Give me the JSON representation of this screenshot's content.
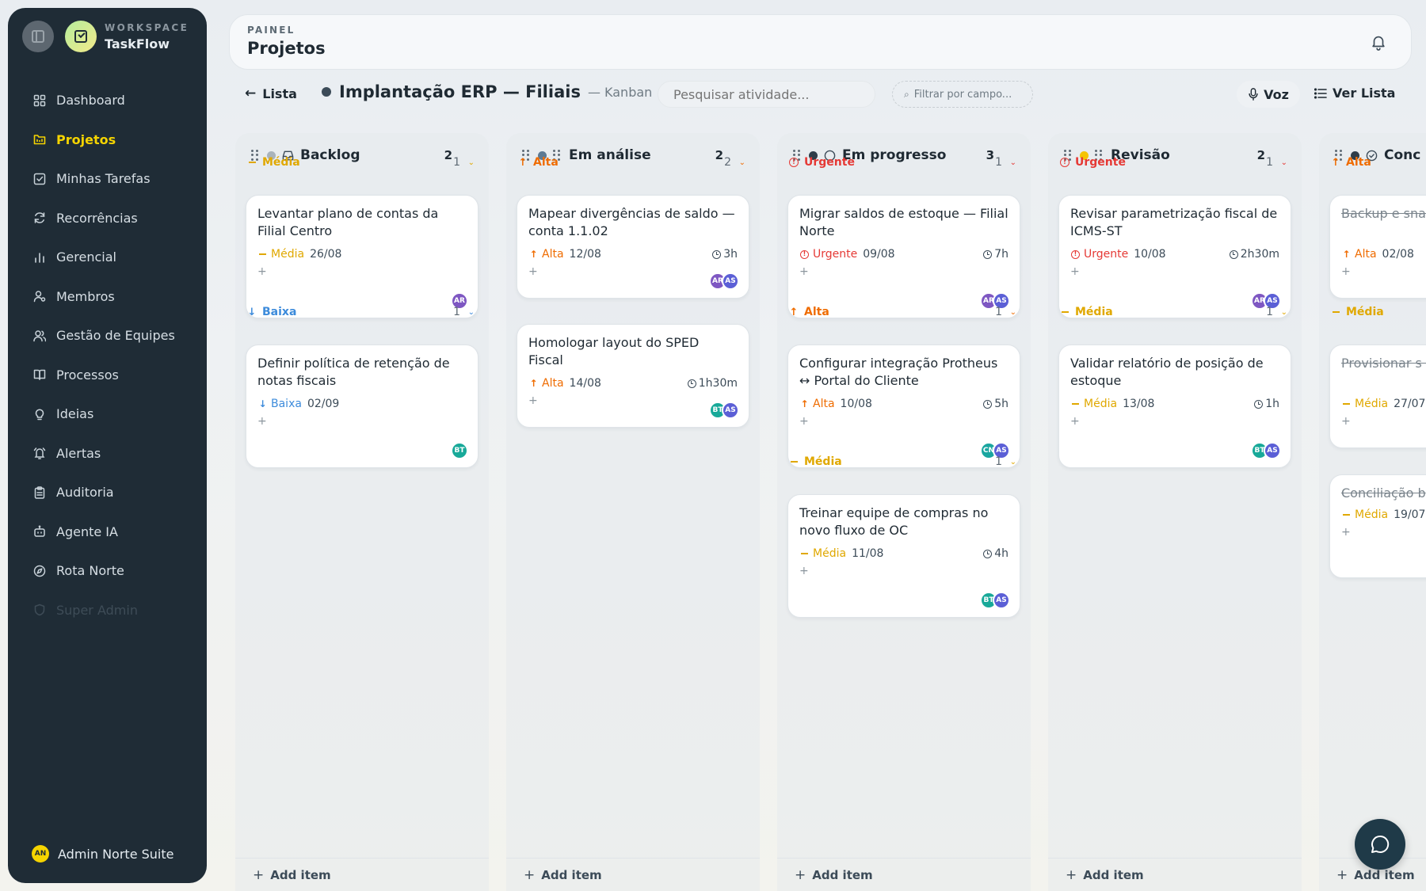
{
  "workspace": {
    "label": "WORKSPACE",
    "name": "TaskFlow"
  },
  "nav": [
    {
      "label": "Dashboard",
      "icon": "grid-icon",
      "state": "normal"
    },
    {
      "label": "Projetos",
      "icon": "folder-icon",
      "state": "active"
    },
    {
      "label": "Minhas Tarefas",
      "icon": "checkbox-icon",
      "state": "normal"
    },
    {
      "label": "Recorrências",
      "icon": "refresh-icon",
      "state": "normal"
    },
    {
      "label": "Gerencial",
      "icon": "bar-chart-icon",
      "state": "normal"
    },
    {
      "label": "Membros",
      "icon": "member-icon",
      "state": "normal"
    },
    {
      "label": "Gestão de Equipes",
      "icon": "users-icon",
      "state": "normal"
    },
    {
      "label": "Processos",
      "icon": "book-icon",
      "state": "normal"
    },
    {
      "label": "Ideias",
      "icon": "bulb-icon",
      "state": "normal"
    },
    {
      "label": "Alertas",
      "icon": "alarm-icon",
      "state": "normal"
    },
    {
      "label": "Auditoria",
      "icon": "clipboard-icon",
      "state": "normal"
    },
    {
      "label": "Agente IA",
      "icon": "bot-icon",
      "state": "normal"
    },
    {
      "label": "Rota Norte",
      "icon": "compass-icon",
      "state": "normal"
    },
    {
      "label": "Super Admin",
      "icon": "shield-icon",
      "state": "disabled"
    }
  ],
  "user": {
    "initials": "AN",
    "name": "Admin Norte Suite"
  },
  "header": {
    "section": "PAINEL",
    "title": "Projetos"
  },
  "toolbar": {
    "back_label": "Lista",
    "project_title": "Implantação ERP — Filiais",
    "view_label": "— Kanban",
    "search_placeholder": "Pesquisar atividade...",
    "filter_placeholder": "Filtrar por campo...",
    "voice_label": "Voz",
    "list_label": "Ver Lista"
  },
  "colors": {
    "accent": "#f5d400",
    "urgent": "#e53935",
    "alta": "#ef6c00",
    "media": "#e0a800",
    "baixa": "#3d8bdb",
    "avatar_AR": "#7e57c2",
    "avatar_AS": "#5b5fd6",
    "avatar_BT": "#18a999",
    "avatar_CN": "#1aa6a0"
  },
  "columns": [
    {
      "title": "Backlog",
      "count": "2",
      "dot": "#a9b3bb",
      "icon": "inbox-icon",
      "groups": [
        {
          "label": "Média",
          "priority": "media",
          "count": "1",
          "cards": [
            {
              "title": "Levantar plano de contas da Filial Centro",
              "priority_label": "Média",
              "date": "26/08",
              "duration": "",
              "avatars": [
                "AR"
              ],
              "done": false
            }
          ]
        },
        {
          "label": "Baixa",
          "priority": "baixa",
          "count": "1",
          "cards": [
            {
              "title": "Definir política de retenção de notas fiscais",
              "priority_label": "Baixa",
              "date": "02/09",
              "duration": "",
              "avatars": [
                "BT"
              ],
              "done": false
            }
          ]
        }
      ]
    },
    {
      "title": "Em análise",
      "count": "2",
      "dot": "#5d7a93",
      "icon": "",
      "groups": [
        {
          "label": "Alta",
          "priority": "alta",
          "count": "2",
          "cards": [
            {
              "title": "Mapear divergências de saldo — conta 1.1.02",
              "priority_label": "Alta",
              "date": "12/08",
              "duration": "3h",
              "avatars": [
                "AR",
                "AS"
              ],
              "done": false
            },
            {
              "title": "Homologar layout do SPED Fiscal",
              "priority_label": "Alta",
              "date": "14/08",
              "duration": "1h30m",
              "avatars": [
                "BT",
                "AS"
              ],
              "done": false
            }
          ]
        }
      ]
    },
    {
      "title": "Em progresso",
      "count": "3",
      "dot": "#2f3d49",
      "icon": "circle-icon",
      "groups": [
        {
          "label": "Urgente",
          "priority": "urgent",
          "count": "1",
          "cards": [
            {
              "title": "Migrar saldos de estoque — Filial Norte",
              "priority_label": "Urgente",
              "date": "09/08",
              "duration": "7h",
              "avatars": [
                "AR",
                "AS"
              ],
              "done": false
            }
          ]
        },
        {
          "label": "Alta",
          "priority": "alta",
          "count": "1",
          "cards": [
            {
              "title": "Configurar integração Protheus ↔ Portal do Cliente",
              "priority_label": "Alta",
              "date": "10/08",
              "duration": "5h",
              "avatars": [
                "CN",
                "AS"
              ],
              "done": false
            }
          ]
        },
        {
          "label": "Média",
          "priority": "media",
          "count": "1",
          "cards": [
            {
              "title": "Treinar equipe de compras no novo fluxo de OC",
              "priority_label": "Média",
              "date": "11/08",
              "duration": "4h",
              "avatars": [
                "BT",
                "AS"
              ],
              "done": false
            }
          ]
        }
      ]
    },
    {
      "title": "Revisão",
      "count": "2",
      "dot": "#f5c400",
      "icon": "",
      "groups": [
        {
          "label": "Urgente",
          "priority": "urgent",
          "count": "1",
          "cards": [
            {
              "title": "Revisar parametrização fiscal de ICMS-ST",
              "priority_label": "Urgente",
              "date": "10/08",
              "duration": "2h30m",
              "avatars": [
                "AR",
                "AS"
              ],
              "done": false
            }
          ]
        },
        {
          "label": "Média",
          "priority": "media",
          "count": "1",
          "cards": [
            {
              "title": "Validar relatório de posição de estoque",
              "priority_label": "Média",
              "date": "13/08",
              "duration": "1h",
              "avatars": [
                "BT",
                "AS"
              ],
              "done": false
            }
          ]
        }
      ]
    },
    {
      "title": "Conc",
      "count": "",
      "dot": "#2f3d49",
      "icon": "check-circle-icon",
      "groups": [
        {
          "label": "Alta",
          "priority": "alta",
          "count": "",
          "cards": [
            {
              "title": "Backup e sna legado",
              "priority_label": "Alta",
              "date": "02/08",
              "duration": "",
              "avatars": [],
              "done": true
            }
          ]
        },
        {
          "label": "Média",
          "priority": "media",
          "count": "",
          "cards": [
            {
              "title": "Provisionar s homologaçã",
              "priority_label": "Média",
              "date": "27/07",
              "duration": "",
              "avatars": [],
              "done": true
            },
            {
              "title": "Conciliação b",
              "priority_label": "Média",
              "date": "19/07",
              "duration": "",
              "avatars": [],
              "done": true
            }
          ]
        }
      ]
    }
  ],
  "add_item_label": "Add item"
}
